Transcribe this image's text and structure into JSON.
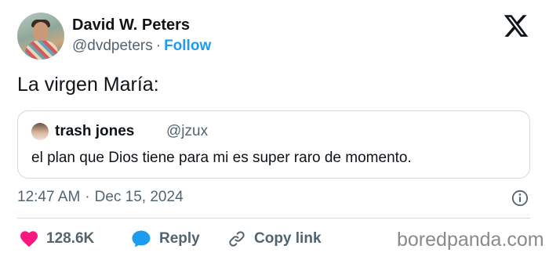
{
  "author": {
    "name": "David W. Peters",
    "handle": "@dvdpeters",
    "separator": "·",
    "follow_label": "Follow"
  },
  "tweet": {
    "text": "La virgen María:",
    "timestamp_time": "12:47 AM",
    "timestamp_separator": "·",
    "timestamp_date": "Dec 15, 2024"
  },
  "quoted_tweet": {
    "name": "trash jones",
    "handle": "@jzux",
    "text": "el plan que Dios tiene para mi es super raro de momento."
  },
  "actions": {
    "like_count": "128.6K",
    "reply_label": "Reply",
    "copy_label": "Copy link"
  },
  "watermark": "boredpanda.com",
  "icons": {
    "brand": "x-logo-icon",
    "info": "info-icon",
    "like": "heart-icon",
    "reply": "speech-bubble-icon",
    "copy": "link-icon"
  },
  "colors": {
    "text": "#0f1419",
    "muted": "#536471",
    "accent": "#1d9bf0",
    "like": "#f91880",
    "border": "#cfd9de",
    "watermark": "#8a8a8a"
  }
}
